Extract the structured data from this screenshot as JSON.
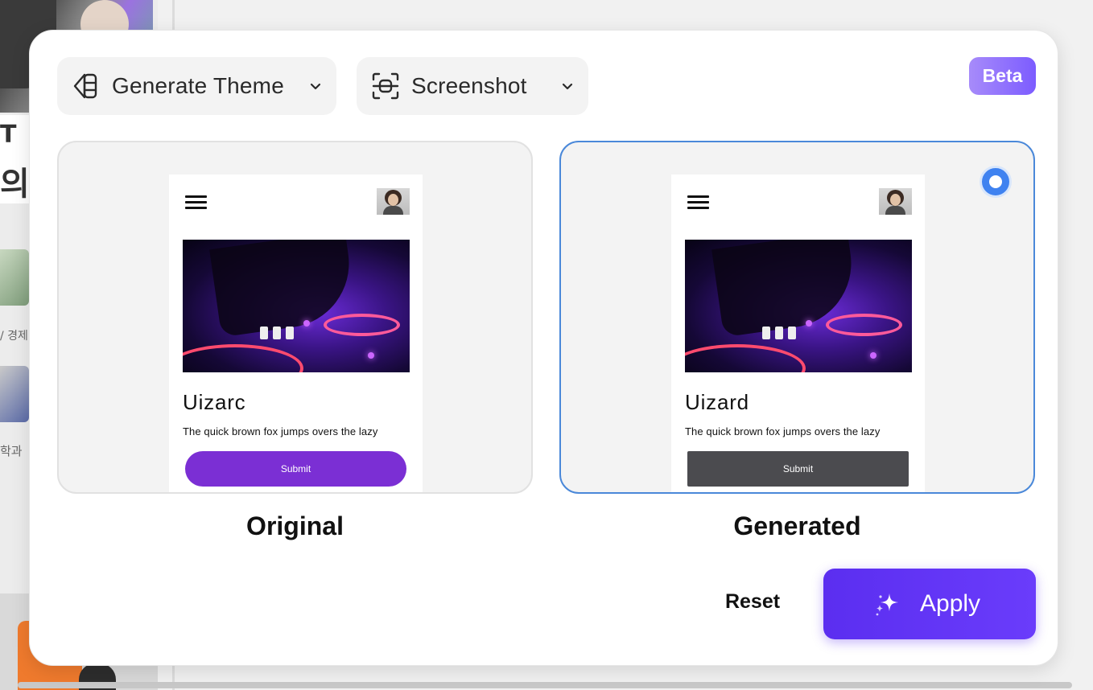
{
  "background": {
    "korean_snippet_1": "의",
    "korean_snippet_2": "/ 경제",
    "korean_snippet_3": "학과",
    "heading_glyph": "T"
  },
  "toolbar": {
    "generate_theme_label": "Generate Theme",
    "screenshot_label": "Screenshot",
    "beta_label": "Beta"
  },
  "previews": {
    "original": {
      "caption": "Original",
      "title": "Uizarc",
      "body": "The quick brown fox jumps overs the lazy",
      "button_label": "Submit",
      "button_color": "#7b2fd4"
    },
    "generated": {
      "caption": "Generated",
      "title": "Uizard",
      "body": "The quick brown fox jumps overs the lazy",
      "button_label": "Submit",
      "button_color": "#4b4b4f",
      "selected": true
    }
  },
  "actions": {
    "reset_label": "Reset",
    "apply_label": "Apply"
  },
  "colors": {
    "accent": "#5b2ef0",
    "selection": "#4a88d9",
    "beta_gradient_start": "#a78bfa",
    "beta_gradient_end": "#7c5cff"
  }
}
